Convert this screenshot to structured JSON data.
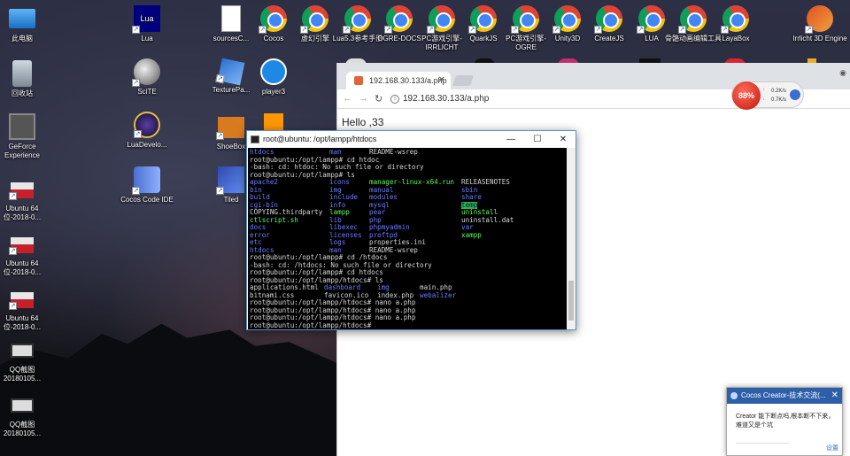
{
  "desktop": {
    "icons": [
      {
        "label": "此电脑",
        "icon": "computer-icon"
      },
      {
        "label": "回收站",
        "icon": "recycle-bin-icon"
      },
      {
        "label": "GeForce Experience",
        "icon": "geforce-icon"
      },
      {
        "label": "Ubuntu 64 位-2018-0...",
        "icon": "ubuntu-vm-icon"
      },
      {
        "label": "Ubuntu 64 位-2018-0...",
        "icon": "ubuntu-vm-icon"
      },
      {
        "label": "Ubuntu 64 位-2018-0...",
        "icon": "ubuntu-vm-icon"
      },
      {
        "label": "QQ截图 20180105...",
        "icon": "screenshot-icon"
      },
      {
        "label": "QQ截图 20180105...",
        "icon": "screenshot-icon"
      },
      {
        "label": "Lua",
        "icon": "lua-icon"
      },
      {
        "label": "SciTE",
        "icon": "scite-icon"
      },
      {
        "label": "LuaDevelo...",
        "icon": "luadevelop-icon"
      },
      {
        "label": "Cocos Code IDE",
        "icon": "cocos-code-ide-icon"
      },
      {
        "label": "sourcesC...",
        "icon": "file-icon"
      },
      {
        "label": "TexturePa...",
        "icon": "texturepacker-icon"
      },
      {
        "label": "ShoeBox",
        "icon": "shoebox-icon"
      },
      {
        "label": "Tiled",
        "icon": "tiled-icon"
      },
      {
        "label": "Cocos",
        "icon": "chrome-icon"
      },
      {
        "label": "player3",
        "icon": "player3-icon"
      },
      {
        "label": "虚幻引擎",
        "icon": "chrome-icon"
      },
      {
        "label": "Lua5.3参考手册",
        "icon": "chrome-icon"
      },
      {
        "label": "OGRE-DOCS",
        "icon": "chrome-icon"
      },
      {
        "label": "PC游戏引擎-IRRLICHT",
        "icon": "chrome-icon"
      },
      {
        "label": "QuarkJS",
        "icon": "chrome-icon"
      },
      {
        "label": "PC游戏引擎-OGRE",
        "icon": "chrome-icon"
      },
      {
        "label": "Unity3D",
        "icon": "chrome-icon"
      },
      {
        "label": "CreateJS",
        "icon": "chrome-icon"
      },
      {
        "label": "LUA",
        "icon": "chrome-icon"
      },
      {
        "label": "骨骼动画编辑工具",
        "icon": "chrome-icon"
      },
      {
        "label": "LayaBox",
        "icon": "chrome-icon"
      },
      {
        "label": "Irrlicht 3D Engine",
        "icon": "irrlicht-icon"
      }
    ]
  },
  "browser": {
    "tab_title": "192.168.30.133/a.php",
    "url": "192.168.30.133/a.php",
    "page_text": "Hello ,33"
  },
  "netmeter": {
    "percent": "88%",
    "up": "0.2K/s",
    "down": "0.7K/s"
  },
  "terminal": {
    "title": "root@ubuntu: /opt/lampp/htdocs",
    "lines": [
      [
        {
          "t": "htdocs",
          "c": "blue",
          "w": 90
        },
        {
          "t": "man",
          "c": "blue",
          "w": 45
        },
        {
          "t": "README-wsrep",
          "c": ""
        }
      ],
      [
        {
          "t": "root@ubuntu:/opt/lampp# cd htdoc",
          "c": ""
        }
      ],
      [
        {
          "t": "-bash: cd: htdoc: No such file or directory",
          "c": ""
        }
      ],
      [
        {
          "t": "root@ubuntu:/opt/lampp# ls",
          "c": ""
        }
      ],
      [
        {
          "t": "apache2",
          "c": "blue",
          "w": 90
        },
        {
          "t": "icons",
          "c": "blue",
          "w": 45
        },
        {
          "t": "manager-linux-x64.run",
          "c": "green",
          "w": 104
        },
        {
          "t": "RELEASENOTES",
          "c": ""
        }
      ],
      [
        {
          "t": "bin",
          "c": "blue",
          "w": 90
        },
        {
          "t": "img",
          "c": "blue",
          "w": 45
        },
        {
          "t": "manual",
          "c": "blue",
          "w": 104
        },
        {
          "t": "sbin",
          "c": "blue"
        }
      ],
      [
        {
          "t": "build",
          "c": "blue",
          "w": 90
        },
        {
          "t": "include",
          "c": "blue",
          "w": 45
        },
        {
          "t": "modules",
          "c": "blue",
          "w": 104
        },
        {
          "t": "share",
          "c": "blue"
        }
      ],
      [
        {
          "t": "cgi-bin",
          "c": "blue",
          "w": 90
        },
        {
          "t": "info",
          "c": "blue",
          "w": 45
        },
        {
          "t": "mysql",
          "c": "blue",
          "w": 104
        },
        {
          "t": "temp",
          "c": "hl"
        }
      ],
      [
        {
          "t": "COPYING.thirdparty",
          "c": "",
          "w": 90
        },
        {
          "t": "lampp",
          "c": "green",
          "w": 45
        },
        {
          "t": "pear",
          "c": "blue",
          "w": 104
        },
        {
          "t": "uninstall",
          "c": "green"
        }
      ],
      [
        {
          "t": "ctlscript.sh",
          "c": "green",
          "w": 90
        },
        {
          "t": "lib",
          "c": "blue",
          "w": 45
        },
        {
          "t": "php",
          "c": "blue",
          "w": 104
        },
        {
          "t": "uninstall.dat",
          "c": ""
        }
      ],
      [
        {
          "t": "docs",
          "c": "blue",
          "w": 90
        },
        {
          "t": "libexec",
          "c": "blue",
          "w": 45
        },
        {
          "t": "phpmyadmin",
          "c": "blue",
          "w": 104
        },
        {
          "t": "var",
          "c": "blue"
        }
      ],
      [
        {
          "t": "error",
          "c": "blue",
          "w": 90
        },
        {
          "t": "licenses",
          "c": "blue",
          "w": 45
        },
        {
          "t": "proftpd",
          "c": "blue",
          "w": 104
        },
        {
          "t": "xampp",
          "c": "green"
        }
      ],
      [
        {
          "t": "etc",
          "c": "blue",
          "w": 90
        },
        {
          "t": "logs",
          "c": "blue",
          "w": 45
        },
        {
          "t": "properties.ini",
          "c": ""
        }
      ],
      [
        {
          "t": "htdocs",
          "c": "blue",
          "w": 90
        },
        {
          "t": "man",
          "c": "blue",
          "w": 45
        },
        {
          "t": "README-wsrep",
          "c": ""
        }
      ],
      [
        {
          "t": "root@ubuntu:/opt/lampp# cd /htdocs",
          "c": ""
        }
      ],
      [
        {
          "t": "-bash: cd: /htdocs: No such file or directory",
          "c": ""
        }
      ],
      [
        {
          "t": "root@ubuntu:/opt/lampp# cd htdocs",
          "c": ""
        }
      ],
      [
        {
          "t": "root@ubuntu:/opt/lampp/htdocs# ls",
          "c": ""
        }
      ],
      [
        {
          "t": "applications.html",
          "c": "",
          "w": 84
        },
        {
          "t": "dashboard",
          "c": "blue",
          "w": 60
        },
        {
          "t": "img",
          "c": "blue",
          "w": 48
        },
        {
          "t": "main.php",
          "c": ""
        }
      ],
      [
        {
          "t": "bitnami.css",
          "c": "",
          "w": 84
        },
        {
          "t": "favicon.ico",
          "c": "",
          "w": 60
        },
        {
          "t": "index.php",
          "c": "",
          "w": 48
        },
        {
          "t": "webalizer",
          "c": "blue"
        }
      ],
      [
        {
          "t": "root@ubuntu:/opt/lampp/htdocs# nano a.php",
          "c": ""
        }
      ],
      [
        {
          "t": "root@ubuntu:/opt/lampp/htdocs# nano a.php",
          "c": ""
        }
      ],
      [
        {
          "t": "root@ubuntu:/opt/lampp/htdocs# nano a.php",
          "c": ""
        }
      ],
      [
        {
          "t": "root@ubuntu:/opt/lampp/htdocs# ",
          "c": ""
        }
      ]
    ]
  },
  "notification": {
    "title": "Cocos Creator-技术交流(...",
    "text": "Creator 能下断点吗,根本断不下来，难道又是个坑",
    "link": "设置"
  }
}
